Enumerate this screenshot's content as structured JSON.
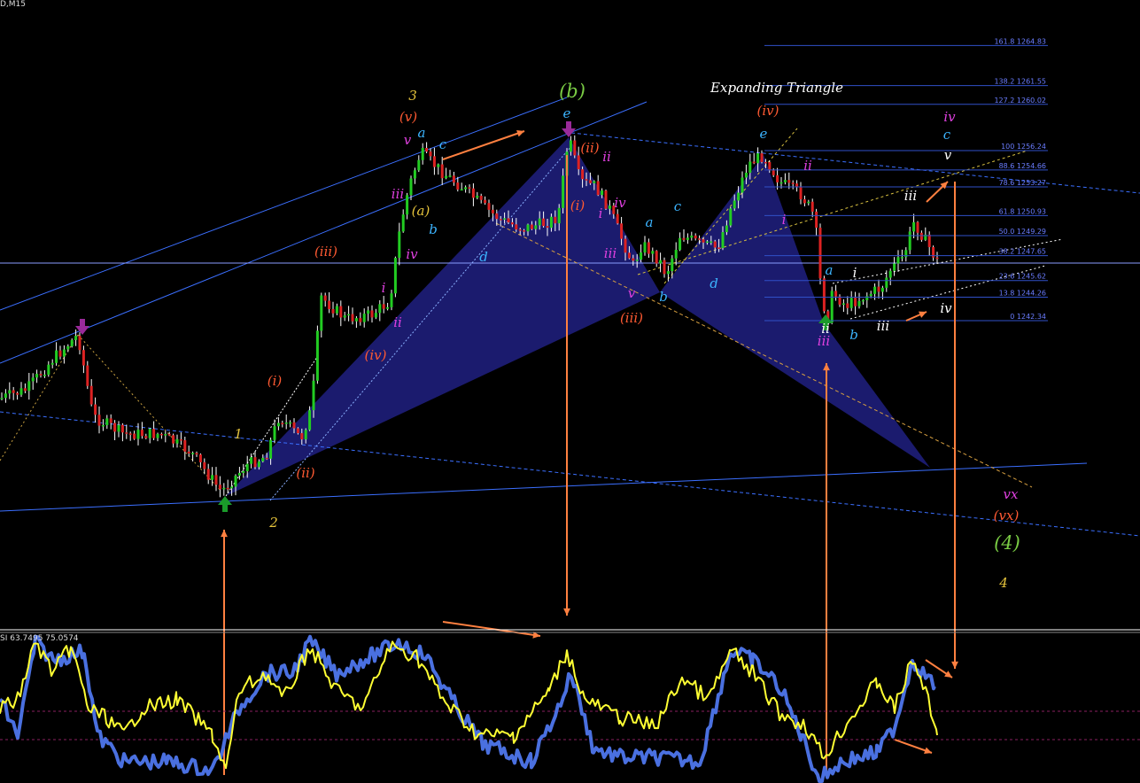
{
  "header": {
    "symbol": "D,M15",
    "indicator_readout": "SI 63.7495 75.0574"
  },
  "colors": {
    "background": "#000000",
    "candle_up": "#22cc22",
    "candle_down": "#dd2222",
    "wick": "#ffffff",
    "channel_line": "#3b6fff",
    "pattern_fill": "#1e1e7a",
    "fib_line": "#3050c8",
    "fib_text": "#6a7dff",
    "arrow": "#ff8040",
    "stoch_main": "#ffff33",
    "stoch_signal": "#4a70e0",
    "level_line": "#8a2060"
  },
  "chart_data": [
    {
      "type": "candlestick",
      "series": [
        {
          "name": "",
          "note": "price path approximated"
        }
      ],
      "fib_levels": [
        {
          "label": "161.8 1264.83",
          "ratio": 161.8,
          "price": 1264.83
        },
        {
          "label": "138.2 1261.55",
          "ratio": 138.2,
          "price": 1261.55
        },
        {
          "label": "127.2 1260.02",
          "ratio": 127.2,
          "price": 1260.02
        },
        {
          "label": "100 1256.24",
          "ratio": 100,
          "price": 1256.24
        },
        {
          "label": "88.6 1254.66",
          "ratio": 88.6,
          "price": 1254.66
        },
        {
          "label": "78.6 1253.27",
          "ratio": 78.6,
          "price": 1253.27
        },
        {
          "label": "61.8 1250.93",
          "ratio": 61.8,
          "price": 1250.93
        },
        {
          "label": "50.0 1249.29",
          "ratio": 50.0,
          "price": 1249.29
        },
        {
          "label": "38.2 1247.65",
          "ratio": 38.2,
          "price": 1247.65
        },
        {
          "label": "23.6 1245.62",
          "ratio": 23.6,
          "price": 1245.62
        },
        {
          "label": "13.8 1244.26",
          "ratio": 13.8,
          "price": 1244.26
        },
        {
          "label": "0 1242.34",
          "ratio": 0,
          "price": 1242.34
        }
      ],
      "annotation_title": "Expanding Triangle",
      "wave_labels": [
        {
          "text": "3",
          "color": "#e6c43c"
        },
        {
          "text": "(v)",
          "color": "#ff5a32"
        },
        {
          "text": "v",
          "color": "#e040e0"
        },
        {
          "text": "a",
          "color": "#3cb4ff"
        },
        {
          "text": "c",
          "color": "#3cb4ff"
        },
        {
          "text": "iii",
          "color": "#e040e0"
        },
        {
          "text": "(a)",
          "color": "#e6c43c"
        },
        {
          "text": "b",
          "color": "#3cb4ff"
        },
        {
          "text": "iv",
          "color": "#e040e0"
        },
        {
          "text": "d",
          "color": "#3cb4ff"
        },
        {
          "text": "(iii)",
          "color": "#ff5a32"
        },
        {
          "text": "i",
          "color": "#e040e0"
        },
        {
          "text": "ii",
          "color": "#e040e0"
        },
        {
          "text": "(iv)",
          "color": "#ff5a32"
        },
        {
          "text": "(i)",
          "color": "#ff5a32"
        },
        {
          "text": "1",
          "color": "#e6c43c"
        },
        {
          "text": "(ii)",
          "color": "#ff5a32"
        },
        {
          "text": "2",
          "color": "#e6c43c"
        },
        {
          "text": "(b)",
          "color": "#7acc44"
        },
        {
          "text": "e",
          "color": "#3cb4ff"
        },
        {
          "text": "(ii)",
          "color": "#ff5a32"
        },
        {
          "text": "ii",
          "color": "#e040e0"
        },
        {
          "text": "(i)",
          "color": "#ff5a32"
        },
        {
          "text": "i",
          "color": "#e040e0"
        },
        {
          "text": "iv",
          "color": "#e040e0"
        },
        {
          "text": "iii",
          "color": "#e040e0"
        },
        {
          "text": "v",
          "color": "#e040e0"
        },
        {
          "text": "(iii)",
          "color": "#ff5a32"
        },
        {
          "text": "a",
          "color": "#3cb4ff"
        },
        {
          "text": "b",
          "color": "#3cb4ff"
        },
        {
          "text": "c",
          "color": "#3cb4ff"
        },
        {
          "text": "d",
          "color": "#3cb4ff"
        },
        {
          "text": "(iv)",
          "color": "#ff5a32"
        },
        {
          "text": "e",
          "color": "#3cb4ff"
        },
        {
          "text": "ii",
          "color": "#e040e0"
        },
        {
          "text": "i",
          "color": "#e040e0"
        },
        {
          "text": "a",
          "color": "#3cb4ff"
        },
        {
          "text": "iii",
          "color": "#e040e0"
        },
        {
          "text": "b",
          "color": "#3cb4ff"
        },
        {
          "text": "i",
          "color": "#ffffff"
        },
        {
          "text": "ii",
          "color": "#ffffff"
        },
        {
          "text": "iii",
          "color": "#ffffff"
        },
        {
          "text": "iv",
          "color": "#ffffff"
        },
        {
          "text": "v",
          "color": "#ffffff"
        },
        {
          "text": "iv",
          "color": "#e040e0"
        },
        {
          "text": "c",
          "color": "#3cb4ff"
        },
        {
          "text": "iii",
          "color": "#ffffff"
        },
        {
          "text": "vx",
          "color": "#e040e0"
        },
        {
          "text": "(vx)",
          "color": "#ff5a32"
        },
        {
          "text": "(4)",
          "color": "#7acc44"
        },
        {
          "text": "4",
          "color": "#e6c43c"
        }
      ]
    },
    {
      "type": "line",
      "name": "stochastic oscillator",
      "readout": [
        63.7495,
        75.0574
      ],
      "series": [
        {
          "name": "",
          "color": "#ffff33"
        },
        {
          "name": "",
          "color": "#4a70e0"
        }
      ]
    }
  ]
}
